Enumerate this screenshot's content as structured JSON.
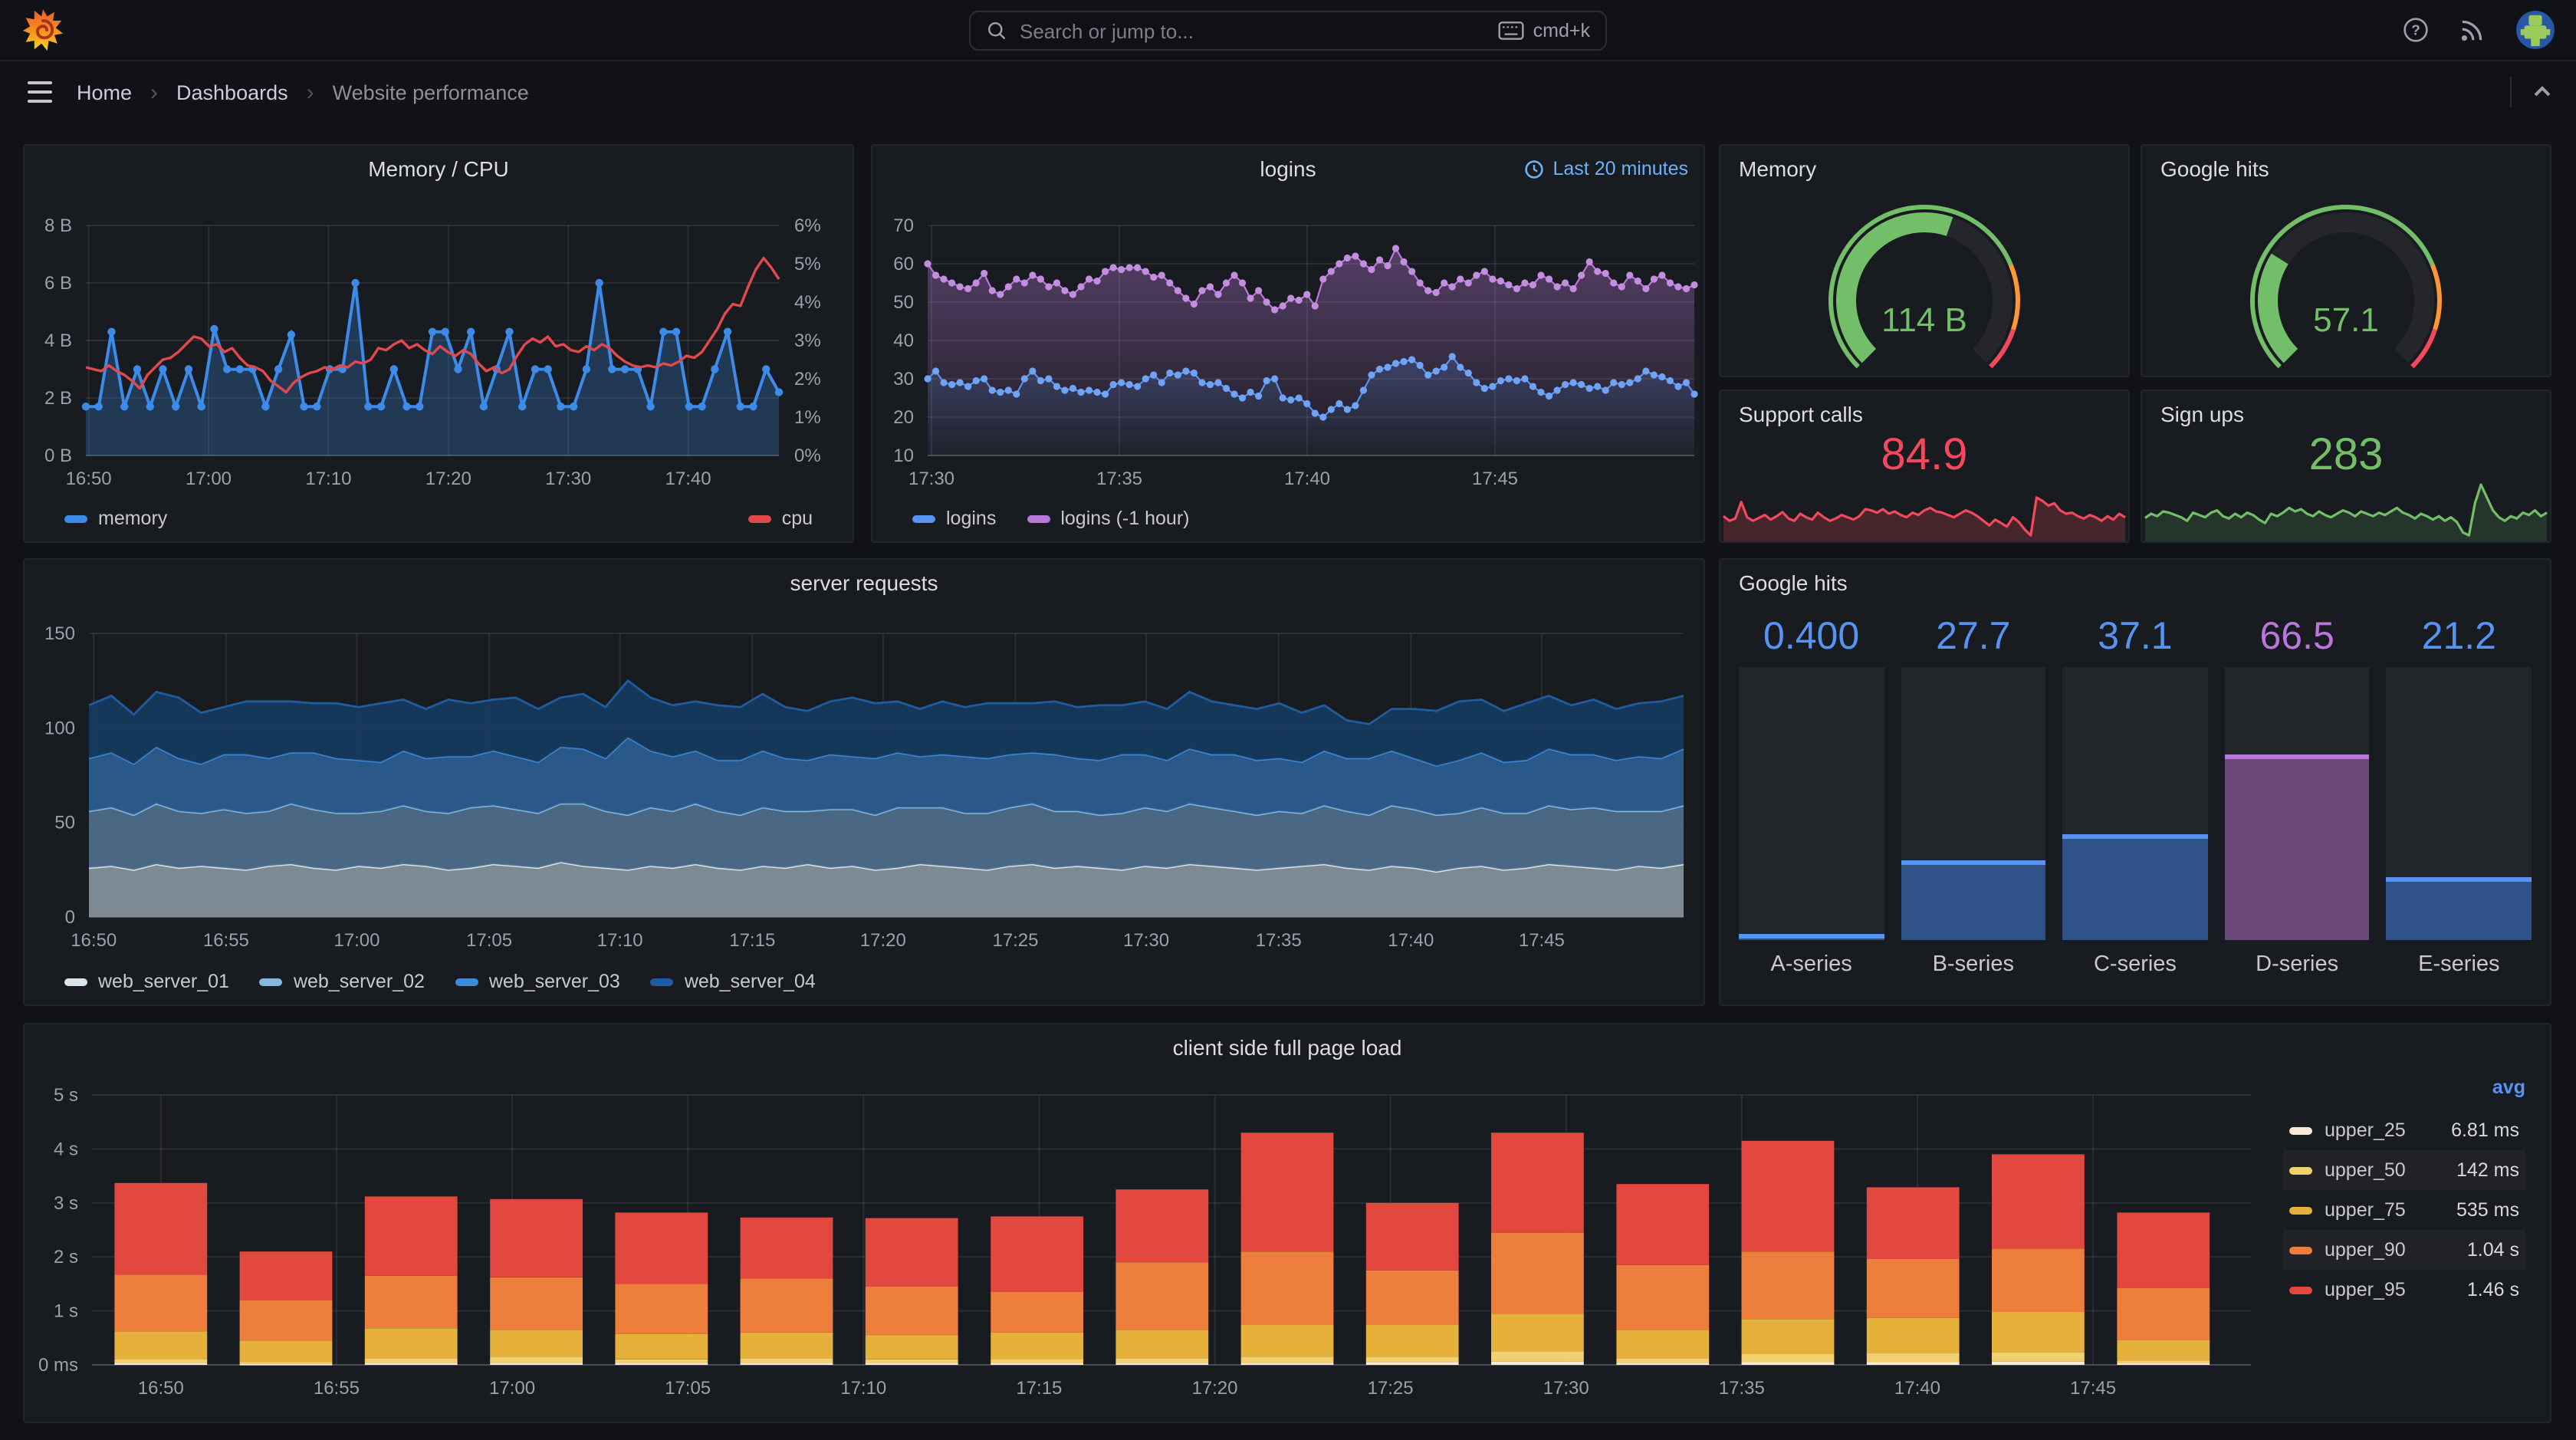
{
  "nav": {
    "search_placeholder": "Search or jump to...",
    "shortcut": "cmd+k"
  },
  "breadcrumb": {
    "items": [
      "Home",
      "Dashboards",
      "Website performance"
    ]
  },
  "colors": {
    "accent_blue": "#5794F2",
    "purple": "#B877D9",
    "green": "#73BF69",
    "red": "#F2495C",
    "orange": "#FF9830"
  },
  "chart_data": [
    {
      "id": "memory_cpu",
      "type": "line",
      "title": "Memory / CPU",
      "x_ticks": [
        "16:50",
        "17:00",
        "17:10",
        "17:20",
        "17:30",
        "17:40"
      ],
      "y_left_ticks": [
        "8 B",
        "6 B",
        "4 B",
        "2 B",
        "0 B"
      ],
      "y_left_range": [
        0,
        8
      ],
      "y_right_ticks": [
        "6%",
        "5%",
        "4%",
        "3%",
        "2%",
        "1%",
        "0%"
      ],
      "y_right_range": [
        0,
        6
      ],
      "series": [
        {
          "name": "memory",
          "axis": "left",
          "color": "#3D8BE8",
          "values": [
            1.7,
            1.7,
            4.3,
            1.7,
            3,
            1.7,
            3,
            1.7,
            3,
            1.7,
            4.4,
            3,
            3,
            3,
            1.7,
            3,
            4.2,
            1.7,
            1.7,
            3,
            3,
            6,
            1.7,
            1.7,
            3,
            1.7,
            1.7,
            4.3,
            4.3,
            3,
            4.3,
            1.7,
            3,
            4.3,
            1.7,
            3,
            3,
            1.7,
            1.7,
            3,
            6,
            3,
            3,
            3,
            1.7,
            4.3,
            4.3,
            1.7,
            1.7,
            3,
            4.3,
            1.7,
            1.7,
            3,
            2.2
          ]
        },
        {
          "name": "cpu",
          "axis": "right",
          "color": "#E2494C",
          "values": [
            2.3,
            2.25,
            2.2,
            2.35,
            2.2,
            2.1,
            1.95,
            1.75,
            2.1,
            2.3,
            2.5,
            2.55,
            2.7,
            2.9,
            3.1,
            3.05,
            2.85,
            2.9,
            2.7,
            2.8,
            2.55,
            2.35,
            2.3,
            2.2,
            1.95,
            1.8,
            1.65,
            1.9,
            2.05,
            2.15,
            2.2,
            2.3,
            2.25,
            2.35,
            2.3,
            2.45,
            2.4,
            2.5,
            2.8,
            2.75,
            2.9,
            3.0,
            2.8,
            2.9,
            2.75,
            2.65,
            2.85,
            2.7,
            2.6,
            2.75,
            2.65,
            2.4,
            2.2,
            2.3,
            2.15,
            2.25,
            2.6,
            2.9,
            3.05,
            2.95,
            3.1,
            2.85,
            2.9,
            2.75,
            2.7,
            2.85,
            2.75,
            2.9,
            2.8,
            2.6,
            2.45,
            2.35,
            2.3,
            2.35,
            2.3,
            2.4,
            2.35,
            2.45,
            2.6,
            2.55,
            2.7,
            3.0,
            3.3,
            3.7,
            3.95,
            3.9,
            4.4,
            4.85,
            5.15,
            4.9,
            4.6
          ]
        }
      ]
    },
    {
      "id": "logins",
      "type": "scatter",
      "title": "logins",
      "time_range": "Last 20 minutes",
      "x_ticks": [
        "17:30",
        "17:35",
        "17:40",
        "17:45"
      ],
      "y_ticks": [
        "70",
        "60",
        "50",
        "40",
        "30",
        "20",
        "10"
      ],
      "y_range": [
        10,
        70
      ],
      "series": [
        {
          "name": "logins",
          "color": "#5794F2",
          "values": [
            30,
            32,
            29,
            28.5,
            29,
            28,
            29.5,
            30,
            27,
            26.5,
            27,
            26,
            30,
            32,
            29.5,
            30,
            28,
            27,
            27.5,
            26.5,
            27,
            26.5,
            26,
            28.5,
            29,
            28.5,
            28,
            30,
            31,
            29,
            31.5,
            31,
            32,
            31.5,
            29,
            28.5,
            29,
            27.5,
            26,
            25,
            26.5,
            25.5,
            29.5,
            30,
            25,
            24.5,
            25,
            23.5,
            21,
            20,
            22,
            23.5,
            22,
            23,
            27,
            31,
            32.5,
            33,
            34,
            34.5,
            35,
            33.5,
            31,
            32,
            33,
            35.8,
            33,
            31.5,
            29,
            27.5,
            28,
            29.5,
            30,
            29.5,
            30,
            28,
            26.5,
            25.5,
            27,
            28.5,
            29,
            28.5,
            27.5,
            28,
            27,
            29,
            28.5,
            29,
            30,
            32,
            31,
            30.5,
            29.5,
            28,
            29,
            26
          ]
        },
        {
          "name": "logins (-1 hour)",
          "color": "#B877D9",
          "values": [
            60,
            57,
            56,
            55,
            54,
            53.5,
            55,
            57.5,
            53,
            52,
            54,
            56,
            55,
            57,
            56,
            54,
            55,
            53,
            52,
            54,
            56,
            55.5,
            58,
            59,
            58.5,
            59,
            59,
            58,
            56.5,
            57,
            55,
            53,
            51,
            49.5,
            53,
            54,
            52,
            55,
            57,
            55,
            51,
            53,
            50,
            48,
            49,
            51,
            50.5,
            52,
            49,
            56,
            58,
            60,
            61.5,
            62,
            60,
            58.5,
            61,
            59.5,
            64,
            60.5,
            58,
            55,
            53,
            52.5,
            55,
            54,
            56,
            55,
            57,
            58,
            56,
            55.5,
            54.5,
            53.5,
            55,
            54.5,
            57,
            56,
            54,
            55,
            53.5,
            57,
            60.5,
            58,
            57.5,
            55,
            54,
            57,
            55.5,
            53.5,
            56,
            57,
            55,
            54,
            53.5,
            54.5
          ]
        }
      ]
    },
    {
      "id": "memory_gauge",
      "type": "gauge",
      "title": "Memory",
      "value": "114 B",
      "fraction": 0.57,
      "color": "#73BF69",
      "thresholds": [
        {
          "color": "#73BF69",
          "upto": 0.75
        },
        {
          "color": "#FF9830",
          "upto": 0.9
        },
        {
          "color": "#F2495C",
          "upto": 1
        }
      ]
    },
    {
      "id": "google_gauge",
      "type": "gauge",
      "title": "Google hits",
      "value": "57.1",
      "fraction": 0.286,
      "color": "#73BF69",
      "thresholds": [
        {
          "color": "#73BF69",
          "upto": 0.75
        },
        {
          "color": "#FF9830",
          "upto": 0.9
        },
        {
          "color": "#F2495C",
          "upto": 1
        }
      ]
    },
    {
      "id": "support_calls",
      "type": "stat-sparkline",
      "title": "Support calls",
      "value": "84.9",
      "color": "#F2495C",
      "values": [
        0.38,
        0.3,
        0.34,
        0.62,
        0.36,
        0.3,
        0.35,
        0.4,
        0.32,
        0.38,
        0.45,
        0.34,
        0.3,
        0.42,
        0.36,
        0.32,
        0.44,
        0.36,
        0.3,
        0.34,
        0.4,
        0.36,
        0.32,
        0.38,
        0.5,
        0.48,
        0.44,
        0.5,
        0.42,
        0.46,
        0.4,
        0.36,
        0.44,
        0.4,
        0.48,
        0.52,
        0.46,
        0.44,
        0.4,
        0.36,
        0.42,
        0.48,
        0.44,
        0.38,
        0.3,
        0.22,
        0.32,
        0.26,
        0.2,
        0.36,
        0.28,
        0.15,
        0.05,
        0.7,
        0.64,
        0.56,
        0.6,
        0.48,
        0.42,
        0.44,
        0.38,
        0.34,
        0.4,
        0.36,
        0.3,
        0.38,
        0.32,
        0.42,
        0.36
      ]
    },
    {
      "id": "sign_ups",
      "type": "stat-sparkline",
      "title": "Sign ups",
      "value": "283",
      "color": "#73BF69",
      "values": [
        0.35,
        0.42,
        0.38,
        0.46,
        0.44,
        0.4,
        0.36,
        0.3,
        0.44,
        0.4,
        0.36,
        0.44,
        0.48,
        0.38,
        0.34,
        0.42,
        0.36,
        0.44,
        0.4,
        0.32,
        0.26,
        0.42,
        0.38,
        0.44,
        0.52,
        0.46,
        0.5,
        0.42,
        0.38,
        0.46,
        0.4,
        0.36,
        0.42,
        0.48,
        0.44,
        0.38,
        0.46,
        0.42,
        0.38,
        0.44,
        0.4,
        0.46,
        0.52,
        0.44,
        0.4,
        0.34,
        0.42,
        0.38,
        0.32,
        0.38,
        0.3,
        0.36,
        0.28,
        0.1,
        0.05,
        0.6,
        0.92,
        0.7,
        0.48,
        0.36,
        0.3,
        0.38,
        0.34,
        0.44,
        0.4,
        0.48,
        0.38,
        0.44
      ]
    },
    {
      "id": "server_requests",
      "type": "area",
      "stacked": true,
      "title": "server requests",
      "x_ticks": [
        "16:50",
        "16:55",
        "17:00",
        "17:05",
        "17:10",
        "17:15",
        "17:20",
        "17:25",
        "17:30",
        "17:35",
        "17:40",
        "17:45"
      ],
      "y_ticks": [
        "150",
        "100",
        "50",
        "0"
      ],
      "y_range": [
        0,
        150
      ],
      "series": [
        {
          "name": "web_server_01",
          "color": "#D9E4EC",
          "fill": "#87939D",
          "values": [
            26,
            27,
            25,
            28,
            26,
            27,
            26,
            25,
            27,
            28,
            26,
            25,
            27,
            26,
            28,
            27,
            25,
            26,
            28,
            27,
            26,
            29,
            27,
            26,
            25,
            27,
            26,
            28,
            26,
            25,
            27,
            26,
            28,
            26,
            27,
            25,
            26,
            28,
            27,
            26,
            25,
            27,
            28,
            26,
            27,
            26,
            25,
            27,
            26,
            28,
            27,
            26,
            25,
            26,
            27,
            28,
            26,
            25,
            27,
            26,
            24,
            26,
            27,
            25,
            26,
            28,
            27,
            26,
            25,
            27,
            26,
            28
          ]
        },
        {
          "name": "web_server_02",
          "color": "#86B7DC",
          "fill": "#4F6F8C",
          "values": [
            30,
            31,
            29,
            32,
            30,
            28,
            31,
            30,
            29,
            32,
            31,
            30,
            28,
            30,
            31,
            29,
            30,
            32,
            31,
            30,
            29,
            31,
            33,
            30,
            29,
            31,
            30,
            32,
            30,
            29,
            31,
            30,
            28,
            31,
            30,
            29,
            32,
            30,
            31,
            29,
            30,
            31,
            32,
            30,
            29,
            28,
            30,
            31,
            30,
            32,
            31,
            30,
            29,
            30,
            28,
            31,
            30,
            29,
            32,
            31,
            30,
            29,
            31,
            30,
            29,
            31,
            30,
            32,
            31,
            29,
            30,
            31
          ]
        },
        {
          "name": "web_server_03",
          "color": "#3E8AD8",
          "fill": "#2D5E93",
          "values": [
            28,
            29,
            27,
            30,
            28,
            26,
            29,
            31,
            28,
            27,
            30,
            29,
            28,
            26,
            29,
            28,
            30,
            27,
            29,
            28,
            27,
            30,
            29,
            28,
            41,
            30,
            29,
            28,
            27,
            29,
            30,
            28,
            27,
            29,
            28,
            30,
            29,
            27,
            28,
            30,
            29,
            28,
            27,
            30,
            28,
            29,
            31,
            28,
            27,
            29,
            28,
            30,
            29,
            28,
            27,
            29,
            28,
            30,
            29,
            27,
            26,
            28,
            29,
            27,
            28,
            30,
            29,
            28,
            27,
            29,
            28,
            30
          ]
        },
        {
          "name": "web_server_04",
          "color": "#1F5C9E",
          "fill": "#16395E",
          "values": [
            28,
            30,
            26,
            29,
            32,
            27,
            25,
            28,
            30,
            27,
            26,
            29,
            28,
            31,
            27,
            26,
            30,
            28,
            27,
            31,
            28,
            26,
            29,
            27,
            30,
            28,
            27,
            26,
            29,
            28,
            30,
            27,
            26,
            28,
            31,
            29,
            27,
            25,
            28,
            26,
            29,
            27,
            26,
            28,
            27,
            29,
            26,
            28,
            27,
            30,
            28,
            26,
            27,
            29,
            26,
            24,
            20,
            18,
            22,
            26,
            29,
            31,
            28,
            27,
            30,
            28,
            26,
            29,
            27,
            28,
            30,
            28
          ]
        }
      ]
    },
    {
      "id": "google_hits_bars",
      "type": "bar",
      "title": "Google hits",
      "categories": [
        "A-series",
        "B-series",
        "C-series",
        "D-series",
        "E-series"
      ],
      "values": [
        0.4,
        27.7,
        37.1,
        66.5,
        21.2
      ],
      "value_labels": [
        "0.400",
        "27.7",
        "37.1",
        "66.5",
        "21.2"
      ],
      "max": 100,
      "colors": [
        "#5794F2",
        "#5794F2",
        "#5794F2",
        "#B877D9",
        "#5794F2"
      ],
      "fills": [
        "#2E5288",
        "#2E5288",
        "#2E5288",
        "#6A4878",
        "#2E5288"
      ]
    },
    {
      "id": "page_load",
      "type": "bar",
      "stacked": true,
      "title": "client side full page load",
      "legend_header": "avg",
      "x_ticks": [
        "16:50",
        "16:55",
        "17:00",
        "17:05",
        "17:10",
        "17:15",
        "17:20",
        "17:25",
        "17:30",
        "17:35",
        "17:40",
        "17:45"
      ],
      "y_ticks": [
        "5 s",
        "4 s",
        "3 s",
        "2 s",
        "1 s",
        "0 ms"
      ],
      "y_range": [
        0,
        5
      ],
      "series": [
        {
          "name": "upper_25",
          "avg": "6.81 ms",
          "color": "#F8E8D8",
          "values": [
            0.04,
            0.02,
            0.04,
            0.04,
            0.03,
            0.03,
            0.03,
            0.03,
            0.04,
            0.04,
            0.05,
            0.06,
            0.04,
            0.05,
            0.05,
            0.06,
            0.03
          ]
        },
        {
          "name": "upper_50",
          "avg": "142 ms",
          "color": "#F2CF6F",
          "values": [
            0.06,
            0.03,
            0.08,
            0.11,
            0.07,
            0.09,
            0.07,
            0.07,
            0.08,
            0.11,
            0.1,
            0.19,
            0.08,
            0.15,
            0.17,
            0.18,
            0.05
          ]
        },
        {
          "name": "upper_75",
          "avg": "535 ms",
          "color": "#E5B13A",
          "values": [
            0.52,
            0.4,
            0.56,
            0.5,
            0.47,
            0.48,
            0.45,
            0.5,
            0.53,
            0.6,
            0.6,
            0.7,
            0.53,
            0.65,
            0.65,
            0.74,
            0.38
          ]
        },
        {
          "name": "upper_90",
          "avg": "1.04 s",
          "color": "#ED7E3B",
          "values": [
            1.05,
            0.75,
            0.97,
            0.97,
            0.93,
            1.0,
            0.9,
            0.75,
            1.25,
            1.35,
            1.0,
            1.5,
            1.2,
            1.25,
            1.09,
            1.17,
            0.97
          ]
        },
        {
          "name": "upper_95",
          "avg": "1.46 s",
          "color": "#E2483D",
          "values": [
            1.7,
            0.9,
            1.47,
            1.45,
            1.32,
            1.13,
            1.27,
            1.4,
            1.35,
            2.2,
            1.25,
            1.85,
            1.5,
            2.05,
            1.33,
            1.75,
            1.39
          ]
        }
      ]
    }
  ]
}
